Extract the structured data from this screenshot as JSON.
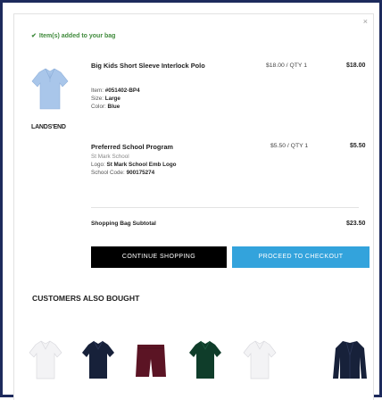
{
  "modal": {
    "close_label": "×",
    "added_msg": "Item(s) added to your bag",
    "brand": "LANDS'END"
  },
  "items": [
    {
      "title": "Big Kids Short Sleeve Interlock Polo",
      "item_label": "Item:",
      "item_no": "#051402-BP4",
      "size_label": "Size:",
      "size": "Large",
      "color_label": "Color:",
      "color": "Blue",
      "unit_price": "$18.00 / QTY 1",
      "total": "$18.00"
    },
    {
      "title": "Preferred School Program",
      "school": "St Mark School",
      "logo_label": "Logo:",
      "logo": "St Mark School Emb Logo",
      "code_label": "School Code:",
      "code": "900175274",
      "unit_price": "$5.50 / QTY 1",
      "total": "$5.50"
    }
  ],
  "subtotal": {
    "label": "Shopping Bag Subtotal",
    "value": "$23.50"
  },
  "buttons": {
    "continue": "CONTINUE SHOPPING",
    "checkout": "PROCEED TO CHECKOUT"
  },
  "recommendations": {
    "heading": "CUSTOMERS ALSO BOUGHT",
    "products": [
      {
        "name": "white-polo-shirt",
        "color": "#f3f3f5"
      },
      {
        "name": "navy-polo-shirt",
        "color": "#17213a"
      },
      {
        "name": "burgundy-shorts",
        "color": "#5b1424"
      },
      {
        "name": "green-polo-shirt",
        "color": "#0f3d2a"
      },
      {
        "name": "white-polo-shirt",
        "color": "#f3f3f5"
      },
      {
        "name": "navy-cardigan",
        "color": "#17213a"
      }
    ]
  },
  "colors": {
    "frame": "#1d2a5c",
    "success": "#3f8a3b",
    "checkout": "#33a3dc",
    "product_blue": "#a9c6ea"
  }
}
